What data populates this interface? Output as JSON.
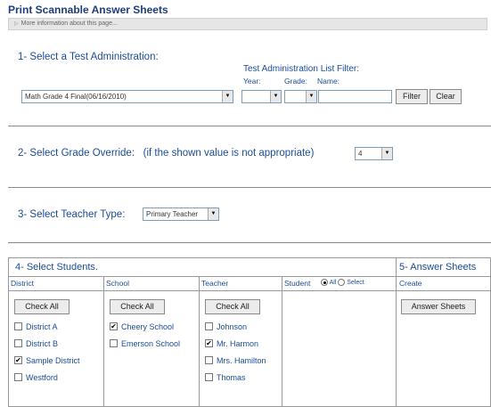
{
  "page": {
    "title": "Print Scannable Answer Sheets",
    "info_link": "More information about this page..."
  },
  "section1": {
    "title": "1- Select a Test Administration:",
    "test_admin_value": "Math Grade 4 Final(06/16/2010)",
    "filter": {
      "title": "Test Administration List Filter:",
      "year_label": "Year:",
      "grade_label": "Grade:",
      "name_label": "Name:",
      "year_value": "",
      "grade_value": "",
      "name_value": "",
      "filter_button": "Filter",
      "clear_button": "Clear"
    }
  },
  "section2": {
    "title": "2- Select Grade Override:",
    "hint": "(if the shown value is not appropriate)",
    "grade_value": "4"
  },
  "section3": {
    "title": "3- Select Teacher Type:",
    "teacher_type_value": "Primary Teacher"
  },
  "section4": {
    "title": "4- Select Students.",
    "columns": {
      "district": "District",
      "school": "School",
      "teacher": "Teacher",
      "student": "Student"
    },
    "student_radio_all": "All",
    "student_radio_select": "Select",
    "check_all_label": "Check All",
    "districts": [
      {
        "label": "District A",
        "checked": false
      },
      {
        "label": "District B",
        "checked": false
      },
      {
        "label": "Sample District",
        "checked": true
      },
      {
        "label": "Westford",
        "checked": false
      }
    ],
    "schools": [
      {
        "label": "Cheery School",
        "checked": true
      },
      {
        "label": "Emerson School",
        "checked": false
      }
    ],
    "teachers": [
      {
        "label": "Johnson",
        "checked": false
      },
      {
        "label": "Mr. Harmon",
        "checked": true
      },
      {
        "label": "Mrs. Hamilton",
        "checked": false
      },
      {
        "label": "Thomas",
        "checked": false
      }
    ]
  },
  "section5": {
    "title": "5- Answer Sheets",
    "create_label": "Create",
    "button": "Answer Sheets"
  }
}
